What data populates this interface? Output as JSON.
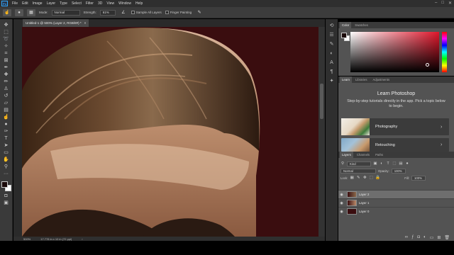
{
  "menubar": {
    "logo": "Ps",
    "items": [
      "File",
      "Edit",
      "Image",
      "Layer",
      "Type",
      "Select",
      "Filter",
      "3D",
      "View",
      "Window",
      "Help"
    ],
    "window_controls": [
      "–",
      "□",
      "✕"
    ]
  },
  "options": {
    "mode_label": "Mode:",
    "mode_value": "Normal",
    "strength_label": "Strength:",
    "strength_value": "61%",
    "sample_all_layers": "Sample All Layers",
    "finger_painting": "Finger Painting"
  },
  "document": {
    "tab_title": "Untitled-1 @ 500% (Layer 2, RGB/8#) *",
    "tab_close": "×"
  },
  "status": {
    "zoom": "500%",
    "dimensions": "17.778 in x 10 in (72 ppi)"
  },
  "colors": {
    "canvas_bg": "#3a0d0f",
    "foreground": "#1a0a0a",
    "background": "#ffffff",
    "accent": "#31a8ff"
  },
  "color_panel": {
    "tabs": [
      "Color",
      "Swatches"
    ]
  },
  "learn_panel": {
    "tabs": [
      "Learn",
      "Libraries",
      "Adjustments"
    ],
    "title": "Learn Photoshop",
    "subtitle": "Step-by-step tutorials directly in the app. Pick a topic below to begin.",
    "cards": [
      {
        "label": "Photography",
        "icon": "chevron-right-icon"
      },
      {
        "label": "Retouching",
        "icon": "chevron-right-icon"
      }
    ]
  },
  "layers_panel": {
    "tabs": [
      "Layers",
      "Channels",
      "Paths"
    ],
    "filter_value": "Kind",
    "blend_mode": "Normal",
    "opacity_label": "Opacity:",
    "opacity_value": "100%",
    "lock_label": "Lock:",
    "fill_label": "Fill:",
    "fill_value": "100%",
    "layers": [
      {
        "name": "Layer 2",
        "selected": true
      },
      {
        "name": "Layer 1",
        "selected": false
      },
      {
        "name": "Layer 0",
        "selected": false
      }
    ]
  }
}
